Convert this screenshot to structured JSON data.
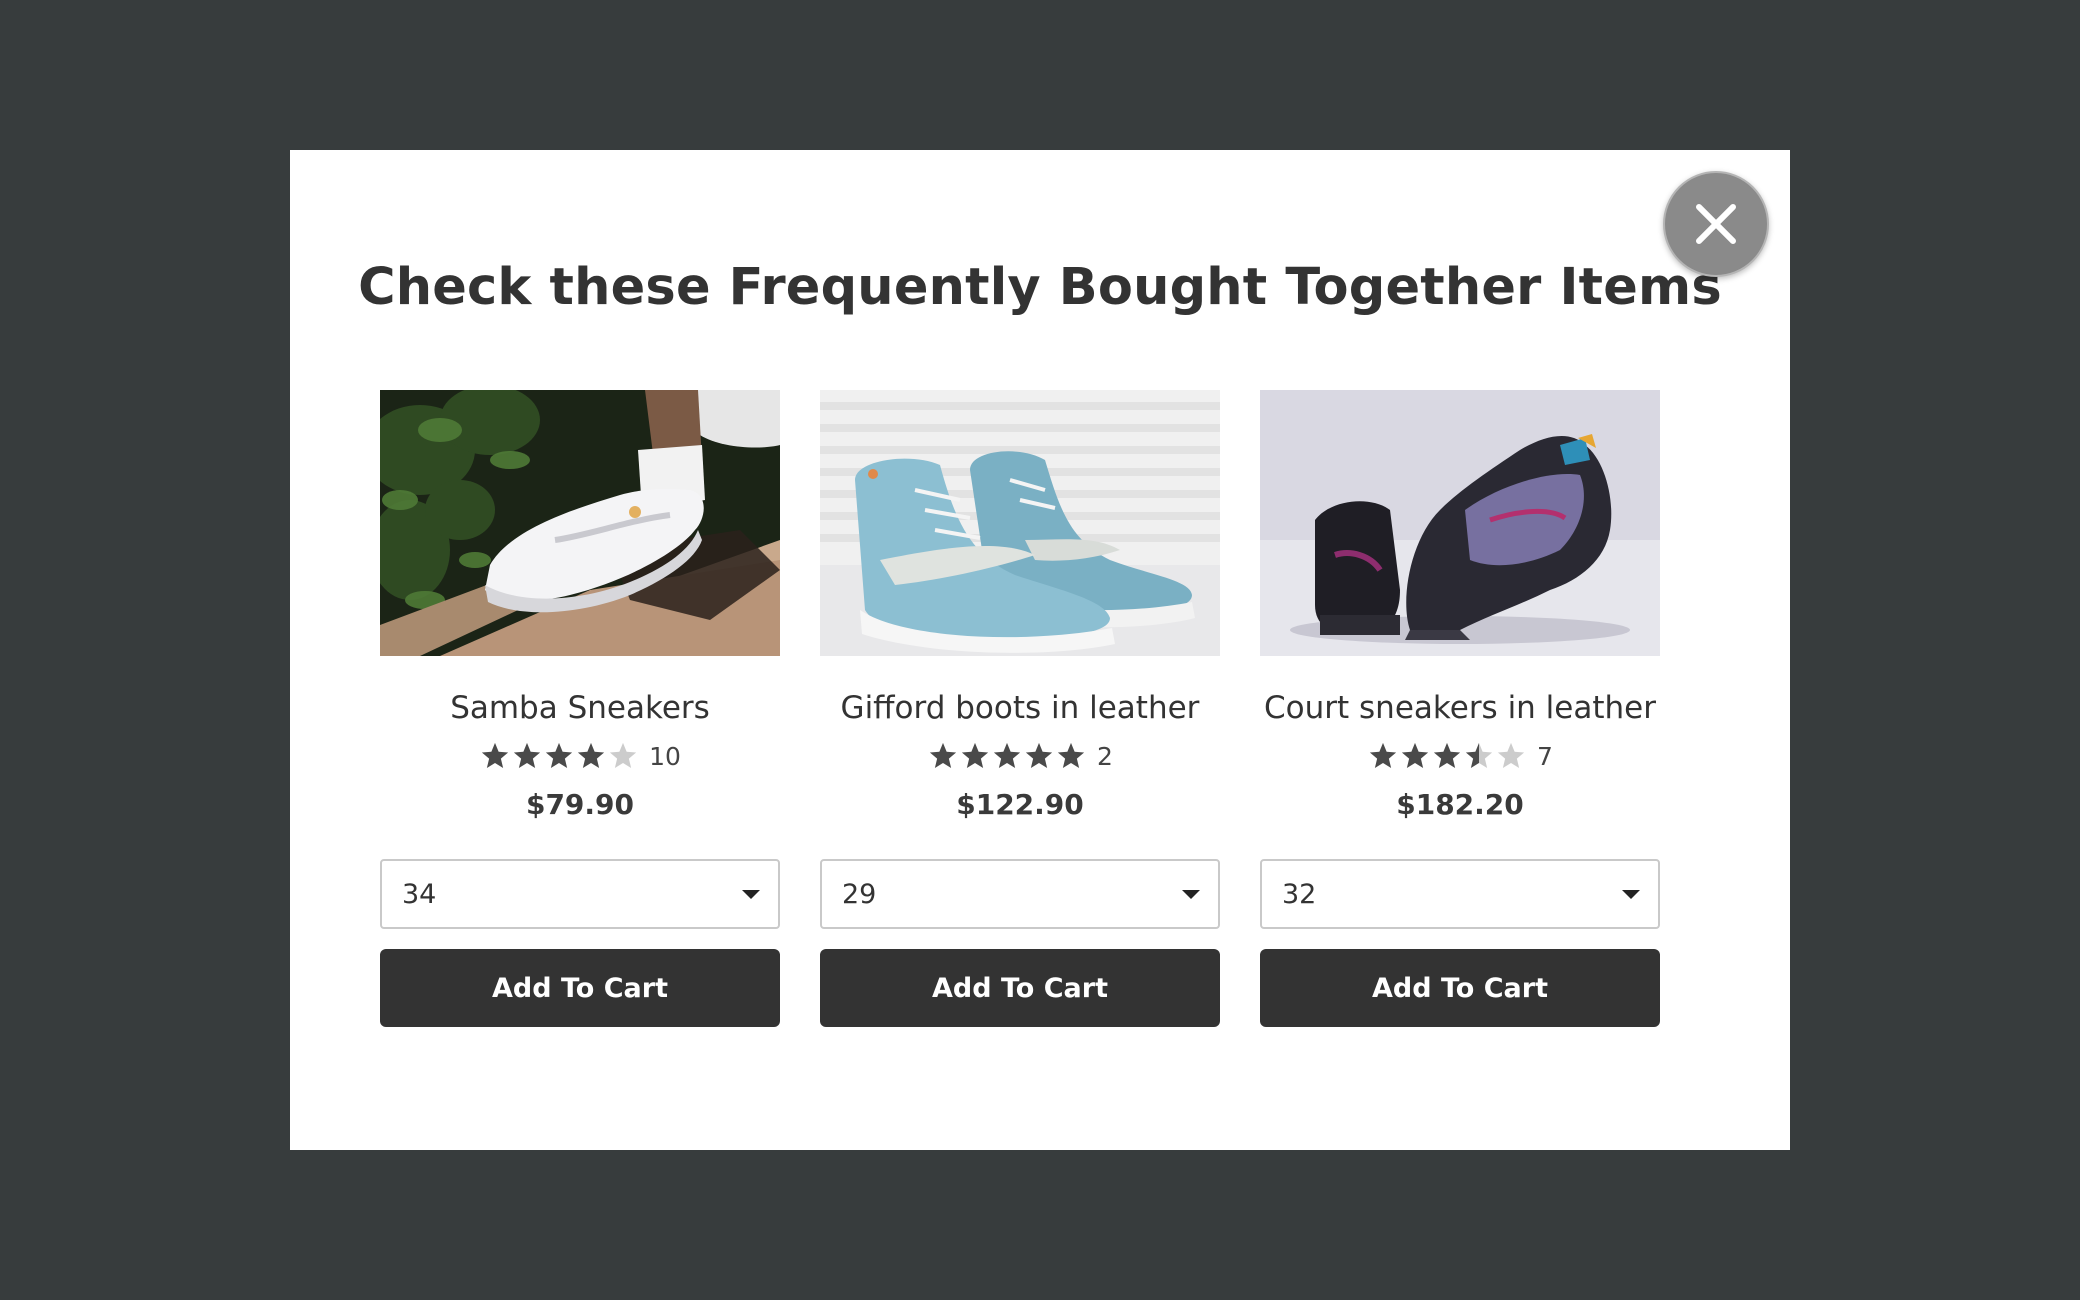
{
  "modal": {
    "title": "Check these Frequently Bought Together Items",
    "close_icon": "close-icon"
  },
  "colors": {
    "backdrop": "#373c3d",
    "button": "#333333",
    "star_filled": "#4a4a4a",
    "star_empty": "#cccccc",
    "close_button": "#8a8a8a"
  },
  "products": [
    {
      "name": "Samba Sneakers",
      "rating": 4,
      "rating_count": "10",
      "price": "$79.90",
      "size": "34",
      "add_label": "Add To Cart",
      "image": "white-sneaker-photo"
    },
    {
      "name": "Gifford boots in leather",
      "rating": 5,
      "rating_count": "2",
      "price": "$122.90",
      "size": "29",
      "add_label": "Add To Cart",
      "image": "blue-suede-high-top-photo"
    },
    {
      "name": "Court sneakers in leather",
      "rating": 3.5,
      "rating_count": "7",
      "price": "$182.20",
      "size": "32",
      "add_label": "Add To Cart",
      "image": "black-purple-basketball-shoe-photo"
    }
  ]
}
